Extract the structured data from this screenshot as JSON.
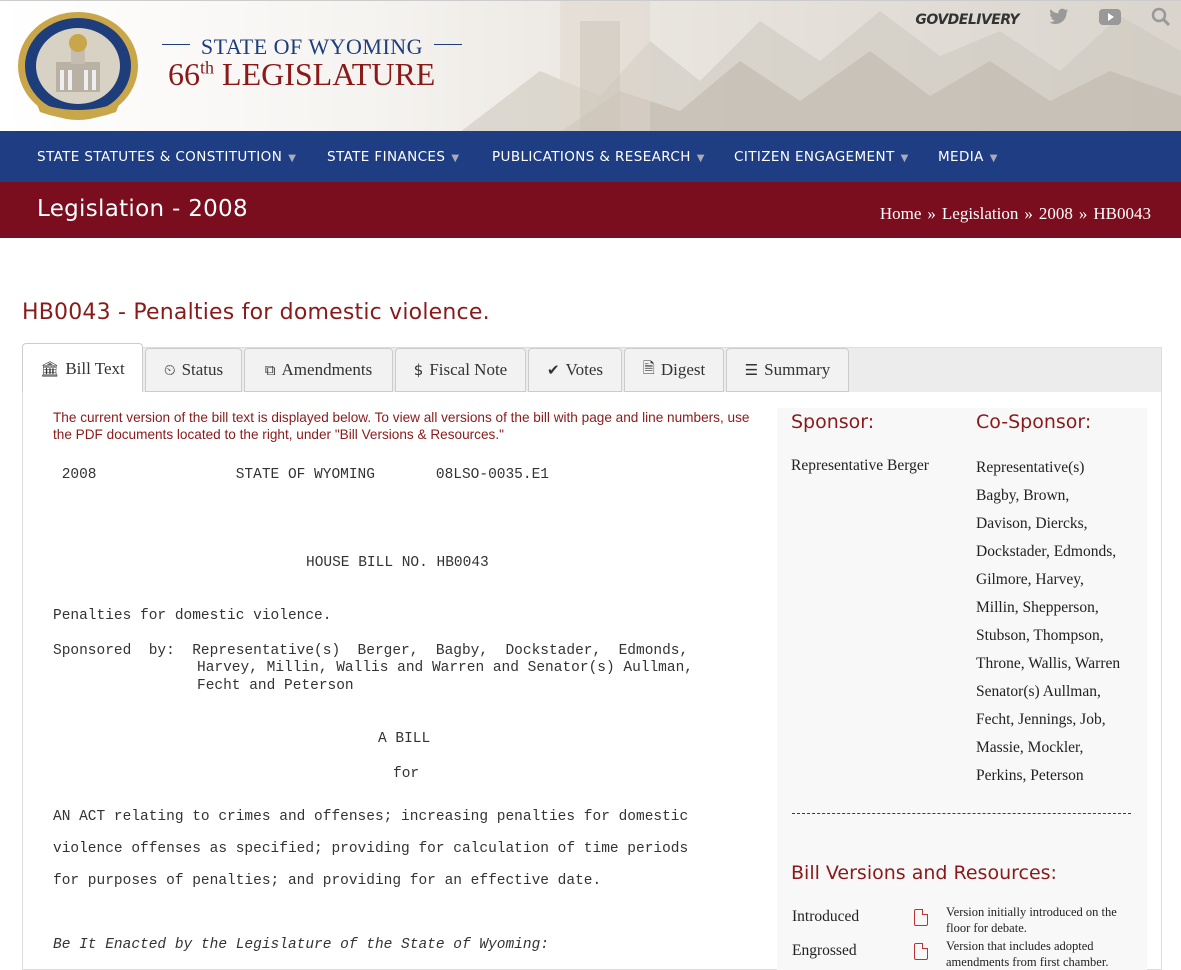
{
  "header": {
    "title_top": "STATE OF WYOMING",
    "title_num": "66",
    "title_sup": "th",
    "title_main": "LEGISLATURE",
    "seal_top": "STATE OF WYOMING",
    "seal_bottom": "LEGISLATURE",
    "govdelivery": "GOVDELIVERY",
    "icons": [
      "twitter-icon",
      "youtube-icon",
      "search-icon"
    ]
  },
  "nav": {
    "items": [
      {
        "label": "STATE STATUTES & CONSTITUTION"
      },
      {
        "label": "STATE FINANCES"
      },
      {
        "label": "PUBLICATIONS & RESEARCH"
      },
      {
        "label": "CITIZEN ENGAGEMENT"
      },
      {
        "label": "MEDIA"
      }
    ]
  },
  "banner": {
    "title": "Legislation - 2008",
    "breadcrumb": [
      "Home",
      "»",
      "Legislation",
      "»",
      "2008",
      "»",
      "HB0043"
    ]
  },
  "page": {
    "title": "HB0043 - Penalties for domestic violence."
  },
  "tabs": [
    {
      "label": "Bill Text",
      "icon": "bank-icon",
      "glyph": "🏛",
      "active": true
    },
    {
      "label": "Status",
      "icon": "clock-icon",
      "glyph": "⏲"
    },
    {
      "label": "Amendments",
      "icon": "copy-icon",
      "glyph": "⧉"
    },
    {
      "label": "Fiscal Note",
      "icon": "dollar-icon",
      "glyph": "$"
    },
    {
      "label": "Votes",
      "icon": "check-icon",
      "glyph": "✔"
    },
    {
      "label": "Digest",
      "icon": "file-icon",
      "glyph": "🗎"
    },
    {
      "label": "Summary",
      "icon": "list-icon",
      "glyph": "☰"
    }
  ],
  "bill": {
    "notice": "The current version of the bill text is displayed below. To view all versions of the bill with page and line numbers, use the PDF documents located to the right, under \"Bill Versions & Resources.\"",
    "header_line": " 2008                STATE OF WYOMING       08LSO-0035.E1",
    "house_bill": "HOUSE BILL NO. HB0043",
    "short_title": "Penalties for domestic violence.",
    "sponsored_1": "Sponsored  by:  Representative(s)  Berger,  Bagby,  Dockstader,  Edmonds,",
    "sponsored_2": "Harvey, Millin, Wallis and Warren and Senator(s) Aullman,",
    "sponsored_3": "Fecht and Peterson",
    "a_bill": "A BILL",
    "for": "for",
    "act_1": "AN ACT relating to crimes and offenses; increasing penalties for domestic",
    "act_2": "violence offenses as specified; providing for calculation of time periods",
    "act_3": "for purposes of penalties; and providing for an effective date.",
    "enacted": "Be It Enacted by the Legislature of the State of Wyoming:"
  },
  "sidebar": {
    "sponsor_heading": "Sponsor:",
    "sponsor": "Representative Berger",
    "cosponsor_heading": "Co-Sponsor:",
    "cosponsors": [
      "Representative(s)",
      "Bagby, Brown,",
      "Davison, Diercks,",
      "Dockstader, Edmonds,",
      "Gilmore, Harvey,",
      "Millin, Shepperson,",
      "Stubson, Thompson,",
      "Throne, Wallis, Warren",
      "Senator(s) Aullman,",
      "Fecht, Jennings, Job,",
      "Massie, Mockler,",
      "Perkins, Peterson"
    ],
    "resources_heading": "Bill Versions and Resources:",
    "resources": [
      {
        "name": "Introduced",
        "desc": "Version initially introduced on the floor for debate."
      },
      {
        "name": "Engrossed",
        "desc": "Version that includes adopted amendments from first chamber."
      }
    ]
  },
  "colors": {
    "nav_bg": "#1e3d82",
    "banner_bg": "#7a0d1e",
    "accent": "#8a1a1a"
  }
}
